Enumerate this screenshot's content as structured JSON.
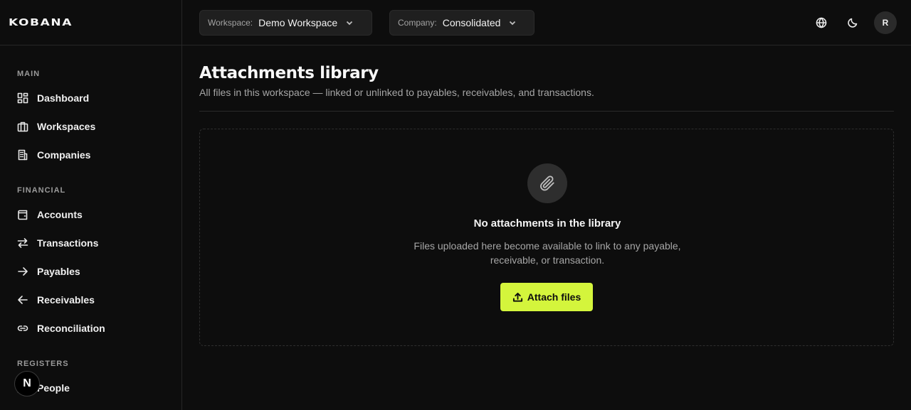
{
  "brand": {
    "logo_text": "KOBANA"
  },
  "sidebar": {
    "sections": [
      {
        "label": "MAIN",
        "items": [
          {
            "label": "Dashboard",
            "icon": "dashboard-icon"
          },
          {
            "label": "Workspaces",
            "icon": "briefcase-icon"
          },
          {
            "label": "Companies",
            "icon": "building-icon"
          }
        ]
      },
      {
        "label": "FINANCIAL",
        "items": [
          {
            "label": "Accounts",
            "icon": "wallet-icon"
          },
          {
            "label": "Transactions",
            "icon": "arrows-left-right-icon"
          },
          {
            "label": "Payables",
            "icon": "arrow-right-icon"
          },
          {
            "label": "Receivables",
            "icon": "arrow-left-icon"
          },
          {
            "label": "Reconciliation",
            "icon": "link-icon"
          }
        ]
      },
      {
        "label": "REGISTERS",
        "items": [
          {
            "label": "People",
            "icon": "people-icon"
          }
        ]
      }
    ],
    "badge_text": "N"
  },
  "topbar": {
    "workspace": {
      "label": "Workspace:",
      "value": "Demo Workspace"
    },
    "company": {
      "label": "Company:",
      "value": "Consolidated"
    },
    "avatar_initial": "R"
  },
  "main": {
    "title": "Attachments library",
    "subtitle": "All files in this workspace — linked or unlinked to payables, receivables, and transactions.",
    "empty_state": {
      "icon": "paperclip-icon",
      "title": "No attachments in the library",
      "description": "Files uploaded here become available to link to any payable, receivable, or transaction.",
      "button_label": "Attach files"
    }
  },
  "colors": {
    "accent": "#d4f53c",
    "background": "#0d0d0d"
  }
}
